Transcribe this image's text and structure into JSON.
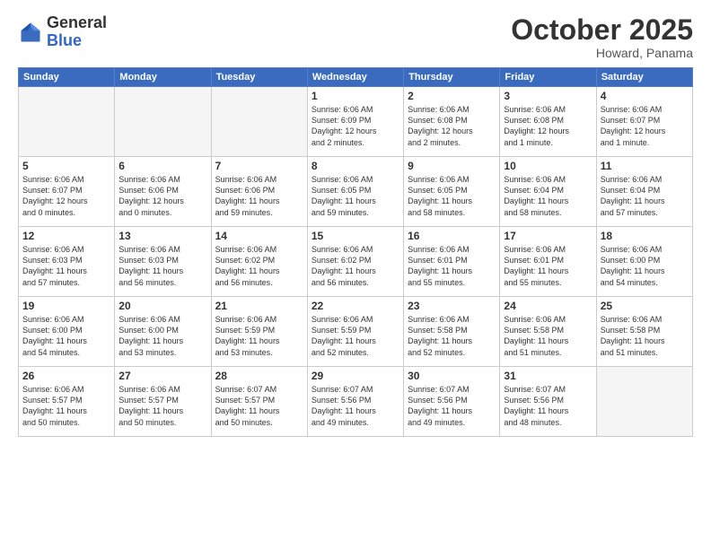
{
  "header": {
    "logo_general": "General",
    "logo_blue": "Blue",
    "month_title": "October 2025",
    "location": "Howard, Panama"
  },
  "weekdays": [
    "Sunday",
    "Monday",
    "Tuesday",
    "Wednesday",
    "Thursday",
    "Friday",
    "Saturday"
  ],
  "weeks": [
    [
      {
        "day": "",
        "info": ""
      },
      {
        "day": "",
        "info": ""
      },
      {
        "day": "",
        "info": ""
      },
      {
        "day": "1",
        "info": "Sunrise: 6:06 AM\nSunset: 6:09 PM\nDaylight: 12 hours\nand 2 minutes."
      },
      {
        "day": "2",
        "info": "Sunrise: 6:06 AM\nSunset: 6:08 PM\nDaylight: 12 hours\nand 2 minutes."
      },
      {
        "day": "3",
        "info": "Sunrise: 6:06 AM\nSunset: 6:08 PM\nDaylight: 12 hours\nand 1 minute."
      },
      {
        "day": "4",
        "info": "Sunrise: 6:06 AM\nSunset: 6:07 PM\nDaylight: 12 hours\nand 1 minute."
      }
    ],
    [
      {
        "day": "5",
        "info": "Sunrise: 6:06 AM\nSunset: 6:07 PM\nDaylight: 12 hours\nand 0 minutes."
      },
      {
        "day": "6",
        "info": "Sunrise: 6:06 AM\nSunset: 6:06 PM\nDaylight: 12 hours\nand 0 minutes."
      },
      {
        "day": "7",
        "info": "Sunrise: 6:06 AM\nSunset: 6:06 PM\nDaylight: 11 hours\nand 59 minutes."
      },
      {
        "day": "8",
        "info": "Sunrise: 6:06 AM\nSunset: 6:05 PM\nDaylight: 11 hours\nand 59 minutes."
      },
      {
        "day": "9",
        "info": "Sunrise: 6:06 AM\nSunset: 6:05 PM\nDaylight: 11 hours\nand 58 minutes."
      },
      {
        "day": "10",
        "info": "Sunrise: 6:06 AM\nSunset: 6:04 PM\nDaylight: 11 hours\nand 58 minutes."
      },
      {
        "day": "11",
        "info": "Sunrise: 6:06 AM\nSunset: 6:04 PM\nDaylight: 11 hours\nand 57 minutes."
      }
    ],
    [
      {
        "day": "12",
        "info": "Sunrise: 6:06 AM\nSunset: 6:03 PM\nDaylight: 11 hours\nand 57 minutes."
      },
      {
        "day": "13",
        "info": "Sunrise: 6:06 AM\nSunset: 6:03 PM\nDaylight: 11 hours\nand 56 minutes."
      },
      {
        "day": "14",
        "info": "Sunrise: 6:06 AM\nSunset: 6:02 PM\nDaylight: 11 hours\nand 56 minutes."
      },
      {
        "day": "15",
        "info": "Sunrise: 6:06 AM\nSunset: 6:02 PM\nDaylight: 11 hours\nand 56 minutes."
      },
      {
        "day": "16",
        "info": "Sunrise: 6:06 AM\nSunset: 6:01 PM\nDaylight: 11 hours\nand 55 minutes."
      },
      {
        "day": "17",
        "info": "Sunrise: 6:06 AM\nSunset: 6:01 PM\nDaylight: 11 hours\nand 55 minutes."
      },
      {
        "day": "18",
        "info": "Sunrise: 6:06 AM\nSunset: 6:00 PM\nDaylight: 11 hours\nand 54 minutes."
      }
    ],
    [
      {
        "day": "19",
        "info": "Sunrise: 6:06 AM\nSunset: 6:00 PM\nDaylight: 11 hours\nand 54 minutes."
      },
      {
        "day": "20",
        "info": "Sunrise: 6:06 AM\nSunset: 6:00 PM\nDaylight: 11 hours\nand 53 minutes."
      },
      {
        "day": "21",
        "info": "Sunrise: 6:06 AM\nSunset: 5:59 PM\nDaylight: 11 hours\nand 53 minutes."
      },
      {
        "day": "22",
        "info": "Sunrise: 6:06 AM\nSunset: 5:59 PM\nDaylight: 11 hours\nand 52 minutes."
      },
      {
        "day": "23",
        "info": "Sunrise: 6:06 AM\nSunset: 5:58 PM\nDaylight: 11 hours\nand 52 minutes."
      },
      {
        "day": "24",
        "info": "Sunrise: 6:06 AM\nSunset: 5:58 PM\nDaylight: 11 hours\nand 51 minutes."
      },
      {
        "day": "25",
        "info": "Sunrise: 6:06 AM\nSunset: 5:58 PM\nDaylight: 11 hours\nand 51 minutes."
      }
    ],
    [
      {
        "day": "26",
        "info": "Sunrise: 6:06 AM\nSunset: 5:57 PM\nDaylight: 11 hours\nand 50 minutes."
      },
      {
        "day": "27",
        "info": "Sunrise: 6:06 AM\nSunset: 5:57 PM\nDaylight: 11 hours\nand 50 minutes."
      },
      {
        "day": "28",
        "info": "Sunrise: 6:07 AM\nSunset: 5:57 PM\nDaylight: 11 hours\nand 50 minutes."
      },
      {
        "day": "29",
        "info": "Sunrise: 6:07 AM\nSunset: 5:56 PM\nDaylight: 11 hours\nand 49 minutes."
      },
      {
        "day": "30",
        "info": "Sunrise: 6:07 AM\nSunset: 5:56 PM\nDaylight: 11 hours\nand 49 minutes."
      },
      {
        "day": "31",
        "info": "Sunrise: 6:07 AM\nSunset: 5:56 PM\nDaylight: 11 hours\nand 48 minutes."
      },
      {
        "day": "",
        "info": ""
      }
    ]
  ]
}
